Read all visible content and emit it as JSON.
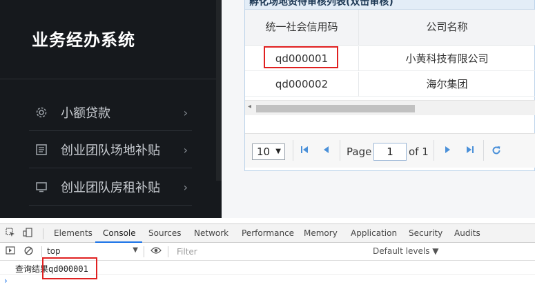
{
  "sidebar": {
    "brand": "业务经办系统",
    "items": [
      {
        "label": "小额贷款",
        "chevron": "›"
      },
      {
        "label": "创业团队场地补贴",
        "chevron": "›"
      },
      {
        "label": "创业团队房租补贴",
        "chevron": "›"
      }
    ]
  },
  "grid": {
    "title": "孵化场地资待审核列表(双击审核)",
    "columns": [
      "统一社会信用码",
      "公司名称"
    ],
    "rows": [
      [
        "qd000001",
        "小黄科技有限公司"
      ],
      [
        "qd000002",
        "海尔集团"
      ]
    ],
    "pager": {
      "page_size": "10",
      "page_label": "Page",
      "page": "1",
      "of_label": "of 1"
    }
  },
  "devtools": {
    "tabs": [
      "Elements",
      "Console",
      "Sources",
      "Network",
      "Performance",
      "Memory",
      "Application",
      "Security",
      "Audits"
    ],
    "active_tab": "Console",
    "context": "top",
    "filter_placeholder": "Filter",
    "levels": "Default levels ▼",
    "console_output_label": "查询结果",
    "console_output_value": "qd000001",
    "prompt": "›"
  },
  "colors": {
    "sidebar_bg": "#16191d",
    "highlight": "#e02020",
    "accent": "#1a73e8"
  }
}
